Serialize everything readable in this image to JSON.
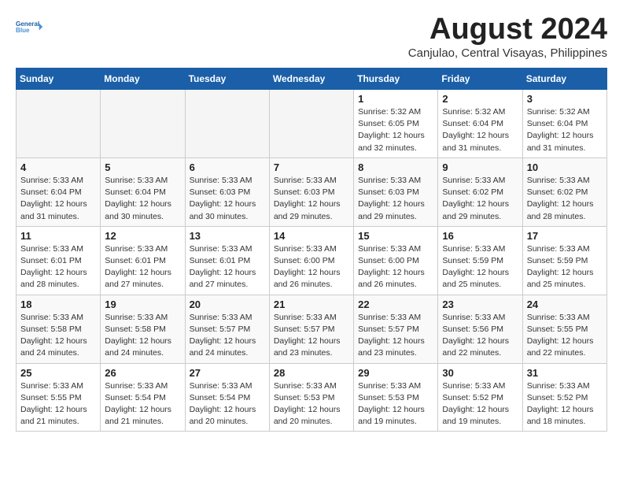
{
  "header": {
    "logo_line1": "General",
    "logo_line2": "Blue",
    "title": "August 2024",
    "subtitle": "Canjulao, Central Visayas, Philippines"
  },
  "days_of_week": [
    "Sunday",
    "Monday",
    "Tuesday",
    "Wednesday",
    "Thursday",
    "Friday",
    "Saturday"
  ],
  "weeks": [
    [
      {
        "day": "",
        "info": ""
      },
      {
        "day": "",
        "info": ""
      },
      {
        "day": "",
        "info": ""
      },
      {
        "day": "",
        "info": ""
      },
      {
        "day": "1",
        "info": "Sunrise: 5:32 AM\nSunset: 6:05 PM\nDaylight: 12 hours\nand 32 minutes."
      },
      {
        "day": "2",
        "info": "Sunrise: 5:32 AM\nSunset: 6:04 PM\nDaylight: 12 hours\nand 31 minutes."
      },
      {
        "day": "3",
        "info": "Sunrise: 5:32 AM\nSunset: 6:04 PM\nDaylight: 12 hours\nand 31 minutes."
      }
    ],
    [
      {
        "day": "4",
        "info": "Sunrise: 5:33 AM\nSunset: 6:04 PM\nDaylight: 12 hours\nand 31 minutes."
      },
      {
        "day": "5",
        "info": "Sunrise: 5:33 AM\nSunset: 6:04 PM\nDaylight: 12 hours\nand 30 minutes."
      },
      {
        "day": "6",
        "info": "Sunrise: 5:33 AM\nSunset: 6:03 PM\nDaylight: 12 hours\nand 30 minutes."
      },
      {
        "day": "7",
        "info": "Sunrise: 5:33 AM\nSunset: 6:03 PM\nDaylight: 12 hours\nand 29 minutes."
      },
      {
        "day": "8",
        "info": "Sunrise: 5:33 AM\nSunset: 6:03 PM\nDaylight: 12 hours\nand 29 minutes."
      },
      {
        "day": "9",
        "info": "Sunrise: 5:33 AM\nSunset: 6:02 PM\nDaylight: 12 hours\nand 29 minutes."
      },
      {
        "day": "10",
        "info": "Sunrise: 5:33 AM\nSunset: 6:02 PM\nDaylight: 12 hours\nand 28 minutes."
      }
    ],
    [
      {
        "day": "11",
        "info": "Sunrise: 5:33 AM\nSunset: 6:01 PM\nDaylight: 12 hours\nand 28 minutes."
      },
      {
        "day": "12",
        "info": "Sunrise: 5:33 AM\nSunset: 6:01 PM\nDaylight: 12 hours\nand 27 minutes."
      },
      {
        "day": "13",
        "info": "Sunrise: 5:33 AM\nSunset: 6:01 PM\nDaylight: 12 hours\nand 27 minutes."
      },
      {
        "day": "14",
        "info": "Sunrise: 5:33 AM\nSunset: 6:00 PM\nDaylight: 12 hours\nand 26 minutes."
      },
      {
        "day": "15",
        "info": "Sunrise: 5:33 AM\nSunset: 6:00 PM\nDaylight: 12 hours\nand 26 minutes."
      },
      {
        "day": "16",
        "info": "Sunrise: 5:33 AM\nSunset: 5:59 PM\nDaylight: 12 hours\nand 25 minutes."
      },
      {
        "day": "17",
        "info": "Sunrise: 5:33 AM\nSunset: 5:59 PM\nDaylight: 12 hours\nand 25 minutes."
      }
    ],
    [
      {
        "day": "18",
        "info": "Sunrise: 5:33 AM\nSunset: 5:58 PM\nDaylight: 12 hours\nand 24 minutes."
      },
      {
        "day": "19",
        "info": "Sunrise: 5:33 AM\nSunset: 5:58 PM\nDaylight: 12 hours\nand 24 minutes."
      },
      {
        "day": "20",
        "info": "Sunrise: 5:33 AM\nSunset: 5:57 PM\nDaylight: 12 hours\nand 24 minutes."
      },
      {
        "day": "21",
        "info": "Sunrise: 5:33 AM\nSunset: 5:57 PM\nDaylight: 12 hours\nand 23 minutes."
      },
      {
        "day": "22",
        "info": "Sunrise: 5:33 AM\nSunset: 5:57 PM\nDaylight: 12 hours\nand 23 minutes."
      },
      {
        "day": "23",
        "info": "Sunrise: 5:33 AM\nSunset: 5:56 PM\nDaylight: 12 hours\nand 22 minutes."
      },
      {
        "day": "24",
        "info": "Sunrise: 5:33 AM\nSunset: 5:55 PM\nDaylight: 12 hours\nand 22 minutes."
      }
    ],
    [
      {
        "day": "25",
        "info": "Sunrise: 5:33 AM\nSunset: 5:55 PM\nDaylight: 12 hours\nand 21 minutes."
      },
      {
        "day": "26",
        "info": "Sunrise: 5:33 AM\nSunset: 5:54 PM\nDaylight: 12 hours\nand 21 minutes."
      },
      {
        "day": "27",
        "info": "Sunrise: 5:33 AM\nSunset: 5:54 PM\nDaylight: 12 hours\nand 20 minutes."
      },
      {
        "day": "28",
        "info": "Sunrise: 5:33 AM\nSunset: 5:53 PM\nDaylight: 12 hours\nand 20 minutes."
      },
      {
        "day": "29",
        "info": "Sunrise: 5:33 AM\nSunset: 5:53 PM\nDaylight: 12 hours\nand 19 minutes."
      },
      {
        "day": "30",
        "info": "Sunrise: 5:33 AM\nSunset: 5:52 PM\nDaylight: 12 hours\nand 19 minutes."
      },
      {
        "day": "31",
        "info": "Sunrise: 5:33 AM\nSunset: 5:52 PM\nDaylight: 12 hours\nand 18 minutes."
      }
    ]
  ]
}
